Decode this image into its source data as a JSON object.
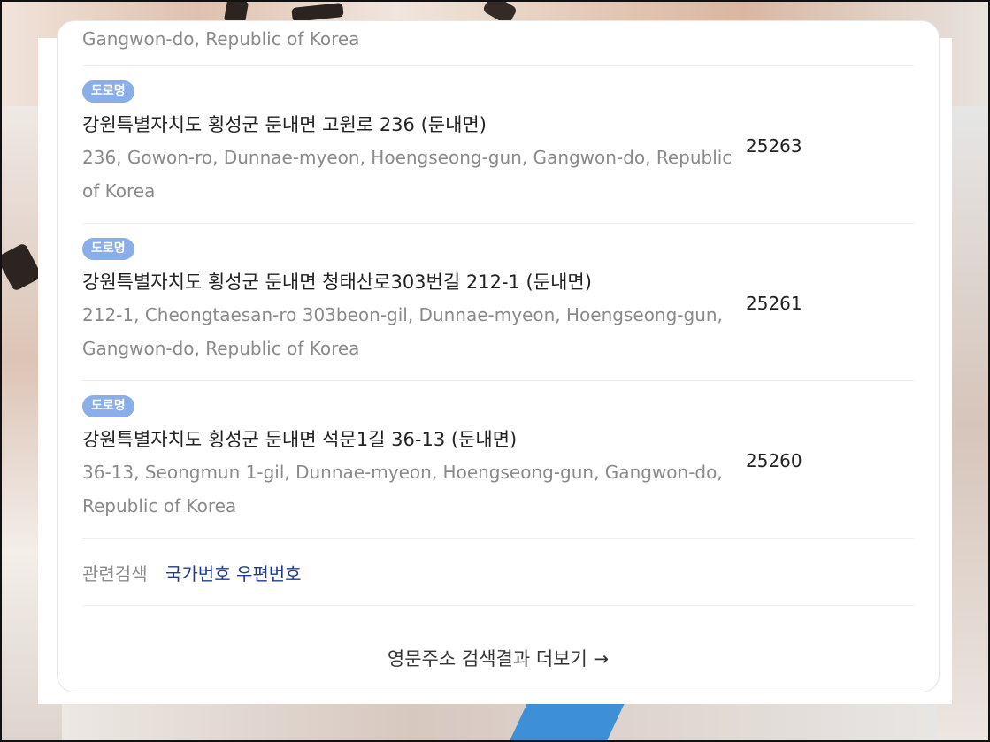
{
  "results": {
    "partial_top_english": "Gangwon-do, Republic of Korea",
    "items": [
      {
        "badge": "도로명",
        "korean": "강원특별자치도 횡성군 둔내면 고원로 236 (둔내면)",
        "english": "236, Gowon-ro, Dunnae-myeon, Hoengseong-gun, Gangwon-do, Republic of Korea",
        "zip": "25263"
      },
      {
        "badge": "도로명",
        "korean": "강원특별자치도 횡성군 둔내면 청태산로303번길 212-1 (둔내면)",
        "english": "212-1, Cheongtaesan-ro 303beon-gil, Dunnae-myeon, Hoengseong-gun, Gangwon-do, Republic of Korea",
        "zip": "25261"
      },
      {
        "badge": "도로명",
        "korean": "강원특별자치도 횡성군 둔내면 석문1길 36-13 (둔내면)",
        "english": "36-13, Seongmun 1-gil, Dunnae-myeon, Hoengseong-gun, Gangwon-do, Republic of Korea",
        "zip": "25260"
      }
    ]
  },
  "related": {
    "label": "관련검색",
    "link": "국가번호 우편번호"
  },
  "more_link": "영문주소 검색결과 더보기 →"
}
